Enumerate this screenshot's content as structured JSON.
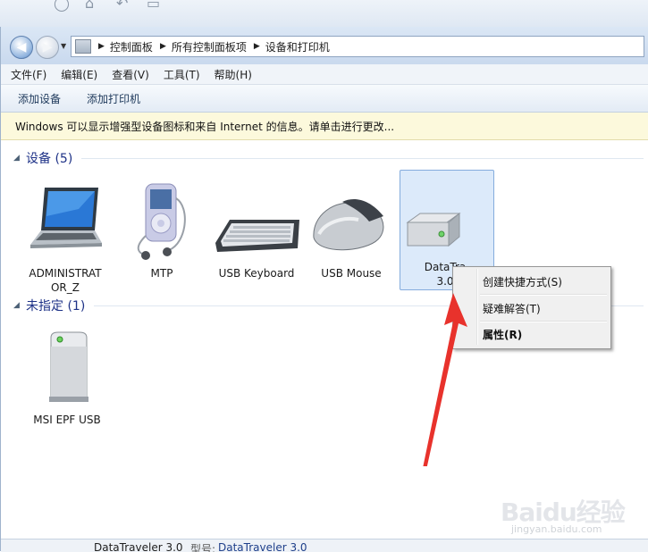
{
  "window": {
    "address": {
      "crumbs": [
        "控制面板",
        "所有控制面板项",
        "设备和打印机"
      ]
    },
    "menu": [
      "文件(F)",
      "编辑(E)",
      "查看(V)",
      "工具(T)",
      "帮助(H)"
    ],
    "commands": [
      "添加设备",
      "添加打印机"
    ],
    "infobar": "Windows 可以显示增强型设备图标和来自 Internet 的信息。请单击进行更改...",
    "groups": [
      {
        "title": "设备 (5)",
        "devices": [
          {
            "label": "ADMINISTRATOR_Z",
            "icon": "laptop-icon"
          },
          {
            "label": "MTP",
            "icon": "media-player-icon"
          },
          {
            "label": "USB Keyboard",
            "icon": "keyboard-icon"
          },
          {
            "label": "USB Mouse",
            "icon": "mouse-icon"
          },
          {
            "label": "DataTra",
            "label2": "3.0",
            "icon": "drive-icon",
            "selected": true
          }
        ]
      },
      {
        "title": "未指定 (1)",
        "devices": [
          {
            "label": "MSI EPF USB",
            "icon": "tower-device-icon"
          }
        ]
      }
    ],
    "context_menu": [
      {
        "label": "创建快捷方式(S)"
      },
      {
        "label": "疑难解答(T)"
      },
      {
        "label": "属性(R)",
        "default": true
      }
    ],
    "status": {
      "device": "DataTraveler 3.0",
      "model_label": "型号:",
      "model_value": "DataTraveler 3.0"
    }
  },
  "watermark": {
    "brand": "Baidu经验",
    "url": "jingyan.baidu.com"
  },
  "annotation": {
    "type": "red-arrow",
    "color": "#e8322c"
  },
  "colors": {
    "group_title": "#1e3287",
    "selection": "#dceafa",
    "infobar": "#fcf9dc"
  }
}
